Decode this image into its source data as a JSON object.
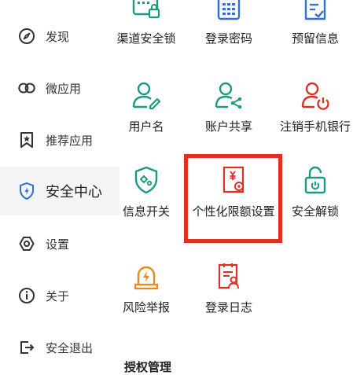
{
  "sidebar": {
    "items": [
      {
        "label": "发现",
        "icon": "compass-icon"
      },
      {
        "label": "微应用",
        "icon": "link-icon"
      },
      {
        "label": "推荐应用",
        "icon": "bookmark-star-icon"
      },
      {
        "label": "安全中心",
        "icon": "shield-icon",
        "active": true
      },
      {
        "label": "设置",
        "icon": "settings-icon"
      },
      {
        "label": "关于",
        "icon": "info-icon"
      },
      {
        "label": "安全退出",
        "icon": "logout-icon"
      }
    ]
  },
  "grid": {
    "tiles": [
      {
        "label": "渠道安全锁",
        "icon": "channel-lock-icon"
      },
      {
        "label": "登录密码",
        "icon": "keypad-icon"
      },
      {
        "label": "预留信息",
        "icon": "document-check-icon"
      },
      {
        "label": "用户名",
        "icon": "user-edit-icon"
      },
      {
        "label": "账户共享",
        "icon": "user-share-icon"
      },
      {
        "label": "注销手机银行",
        "icon": "user-power-icon"
      },
      {
        "label": "信息开关",
        "icon": "shield-gear-icon"
      },
      {
        "label": "个性化限额设置",
        "icon": "limit-setting-icon"
      },
      {
        "label": "安全解锁",
        "icon": "unlock-icon"
      },
      {
        "label": "风险举报",
        "icon": "risk-alarm-icon"
      },
      {
        "label": "登录日志",
        "icon": "login-log-icon"
      }
    ],
    "section_title": "授权管理"
  },
  "colors": {
    "teal": "#1a9a82",
    "blue": "#2f6fd6",
    "red": "#e03026",
    "orange": "#e8891d",
    "highlight": "#e03026"
  }
}
